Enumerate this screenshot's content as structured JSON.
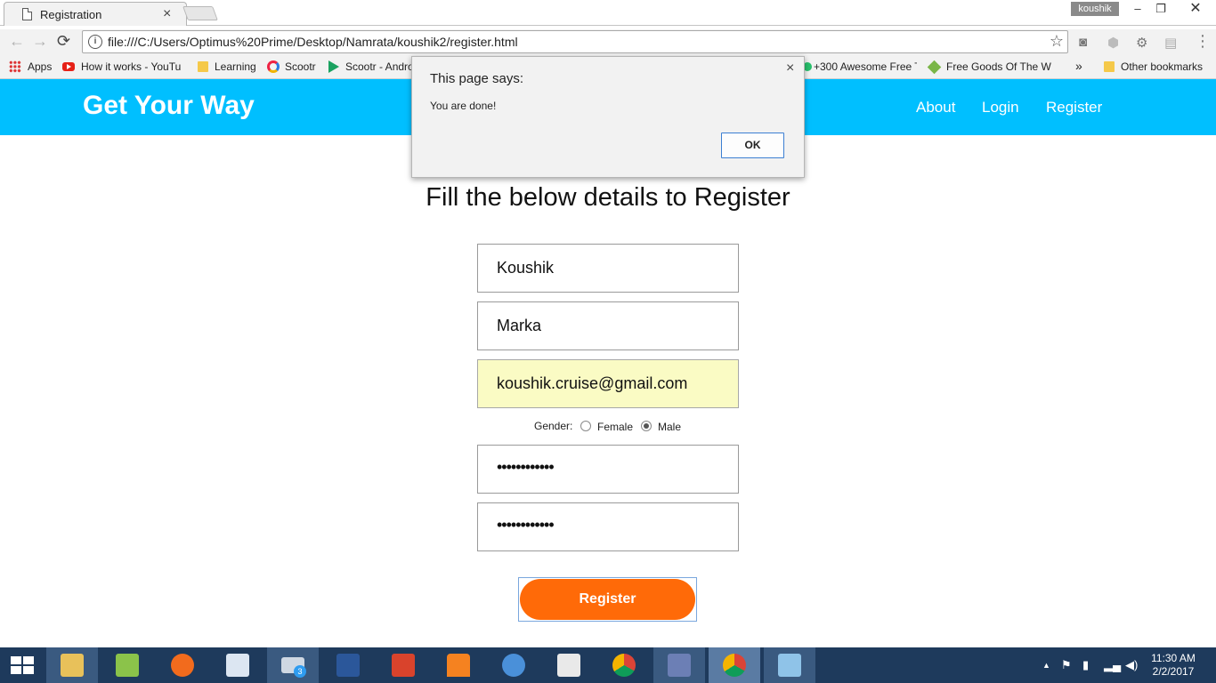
{
  "browser": {
    "tab_title": "Registration",
    "tab_close": "×",
    "user_name": "koushik",
    "window_min": "–",
    "window_restore": "❐",
    "window_close": "✕",
    "back_glyph": "←",
    "forward_glyph": "→",
    "reload_glyph": "⟳",
    "info_glyph": "i",
    "url": "file:///C:/Users/Optimus%20Prime/Desktop/Namrata/koushik2/register.html",
    "star_glyph": "☆",
    "menu_glyph": "⋮"
  },
  "bookmarks": {
    "items": [
      {
        "label": "Apps",
        "icon": "apps-grid-icon"
      },
      {
        "label": "How it works - YouTu",
        "icon": "youtube-icon"
      },
      {
        "label": "Learning",
        "icon": "folder-icon"
      },
      {
        "label": "Scootr",
        "icon": "ring-icon"
      },
      {
        "label": "Scootr - Andro",
        "icon": "play-store-icon"
      },
      {
        "label": "+300 Awesome Free T",
        "icon": "green-dot-icon"
      },
      {
        "label": "Free Goods Of The W",
        "icon": "tag-icon"
      },
      {
        "label": "Other bookmarks",
        "icon": "folder-icon"
      }
    ],
    "overflow": "»"
  },
  "site": {
    "brand": "Get Your Way",
    "nav": {
      "about": "About",
      "login": "Login",
      "register": "Register"
    }
  },
  "form": {
    "heading": "Fill the below details to Register",
    "first_name": "Koushik",
    "last_name": "Marka",
    "email": "koushik.cruise@gmail.com",
    "gender_label": "Gender:",
    "gender_options": {
      "female": "Female",
      "male": "Male"
    },
    "gender_selected": "Male",
    "password_mask": "••••••••••••",
    "confirm_mask": "••••••••••••",
    "submit": "Register"
  },
  "dialog": {
    "title": "This page says:",
    "message": "You are done!",
    "ok": "OK",
    "close": "×"
  },
  "taskbar": {
    "mail_badge": "3",
    "time": "11:30 AM",
    "date": "2/2/2017",
    "tray_up": "▲"
  }
}
